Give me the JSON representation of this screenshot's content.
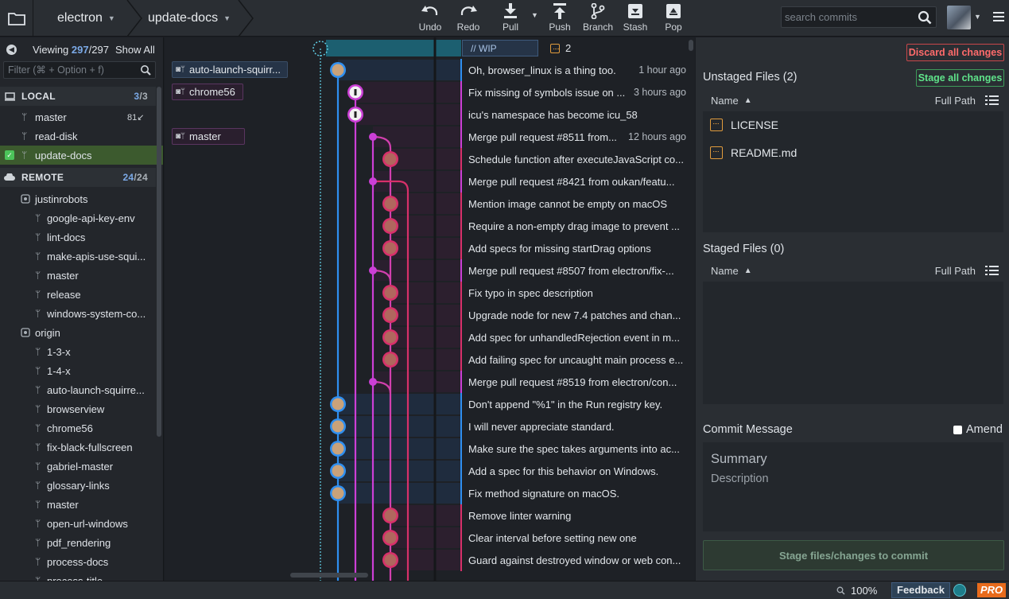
{
  "topbar": {
    "repo_name": "electron",
    "branch_name": "update-docs",
    "tools": [
      {
        "label": "Undo",
        "icon": "undo-icon"
      },
      {
        "label": "Redo",
        "icon": "redo-icon"
      },
      {
        "label": "Pull",
        "icon": "pull-icon"
      },
      {
        "label": "Push",
        "icon": "push-icon"
      },
      {
        "label": "Branch",
        "icon": "branch-icon"
      },
      {
        "label": "Stash",
        "icon": "stash-icon"
      },
      {
        "label": "Pop",
        "icon": "pop-icon"
      }
    ],
    "search_placeholder": "search commits"
  },
  "sidebar": {
    "viewing_label": "Viewing",
    "viewing_count": "297",
    "viewing_total": "/297",
    "show_all": "Show All",
    "filter_placeholder": "Filter (⌘ + Option + f)",
    "local_header": "LOCAL",
    "local_count": "3",
    "local_total": "/3",
    "local_branches": [
      {
        "name": "master",
        "badge": "81↙"
      },
      {
        "name": "read-disk",
        "badge": ""
      },
      {
        "name": "update-docs",
        "badge": ""
      }
    ],
    "remote_header": "REMOTE",
    "remote_count": "24",
    "remote_total": "/24",
    "remote_items": [
      {
        "name": "justinrobots",
        "type": "remote"
      },
      {
        "name": "google-api-key-env",
        "type": "branch"
      },
      {
        "name": "lint-docs",
        "type": "branch"
      },
      {
        "name": "make-apis-use-squi...",
        "type": "branch"
      },
      {
        "name": "master",
        "type": "branch"
      },
      {
        "name": "release",
        "type": "branch"
      },
      {
        "name": "windows-system-co...",
        "type": "branch"
      },
      {
        "name": "origin",
        "type": "remote"
      },
      {
        "name": "1-3-x",
        "type": "branch"
      },
      {
        "name": "1-4-x",
        "type": "branch"
      },
      {
        "name": "auto-launch-squirre...",
        "type": "branch"
      },
      {
        "name": "browserview",
        "type": "branch"
      },
      {
        "name": "chrome56",
        "type": "branch"
      },
      {
        "name": "fix-black-fullscreen",
        "type": "branch"
      },
      {
        "name": "gabriel-master",
        "type": "branch"
      },
      {
        "name": "glossary-links",
        "type": "branch"
      },
      {
        "name": "master",
        "type": "branch"
      },
      {
        "name": "open-url-windows",
        "type": "branch"
      },
      {
        "name": "pdf_rendering",
        "type": "branch"
      },
      {
        "name": "process-docs",
        "type": "branch"
      },
      {
        "name": "process-title",
        "type": "branch"
      }
    ]
  },
  "graph": {
    "wip_label": "// WIP",
    "wip_count": "2",
    "refs": [
      {
        "row": 0,
        "label": "auto-launch-squirr..."
      },
      {
        "row": 1,
        "label": "chrome56"
      },
      {
        "row": 3,
        "label": "master"
      }
    ],
    "commits": [
      {
        "msg": "Oh, browser_linux is a thing too.",
        "time": "1 hour ago",
        "lane": 0
      },
      {
        "msg": "Fix missing of symbols issue on ...",
        "time": "3 hours ago",
        "lane": 1
      },
      {
        "msg": "icu's namespace has become icu_58",
        "time": "",
        "lane": 1
      },
      {
        "msg": "Merge pull request #8511 from...",
        "time": "12 hours ago",
        "lane": 2
      },
      {
        "msg": "Schedule function after executeJavaScript co...",
        "time": "",
        "lane": 3
      },
      {
        "msg": "Merge pull request #8421 from oukan/featu...",
        "time": "",
        "lane": 2
      },
      {
        "msg": "Mention image cannot be empty on macOS",
        "time": "",
        "lane": 3
      },
      {
        "msg": "Require a non-empty drag image to prevent ...",
        "time": "",
        "lane": 3
      },
      {
        "msg": "Add specs for missing startDrag options",
        "time": "",
        "lane": 3
      },
      {
        "msg": "Merge pull request #8507 from electron/fix-...",
        "time": "",
        "lane": 2
      },
      {
        "msg": "Fix typo in spec description",
        "time": "",
        "lane": 3
      },
      {
        "msg": "Upgrade node for new 7.4 patches and chan...",
        "time": "",
        "lane": 3
      },
      {
        "msg": "Add spec for unhandledRejection event in m...",
        "time": "",
        "lane": 3
      },
      {
        "msg": "Add failing spec for uncaught main process e...",
        "time": "",
        "lane": 3
      },
      {
        "msg": "Merge pull request #8519 from electron/con...",
        "time": "",
        "lane": 2
      },
      {
        "msg": "Don't append \"%1\" in the Run registry key.",
        "time": "",
        "lane": 0
      },
      {
        "msg": "I will never appreciate standard.",
        "time": "",
        "lane": 0
      },
      {
        "msg": "Make sure the spec takes arguments into ac...",
        "time": "",
        "lane": 0
      },
      {
        "msg": "Add a spec for this behavior on Windows.",
        "time": "",
        "lane": 0
      },
      {
        "msg": "Fix method signature on macOS.",
        "time": "",
        "lane": 0
      },
      {
        "msg": "Remove linter warning",
        "time": "",
        "lane": 3
      },
      {
        "msg": "Clear interval before setting new one",
        "time": "",
        "lane": 3
      },
      {
        "msg": "Guard against destroyed window or web con...",
        "time": "",
        "lane": 3
      }
    ],
    "lane_colors": [
      "#2f8ff0",
      "#cc3fd6",
      "#cc3fd6",
      "#d8306a"
    ]
  },
  "right": {
    "discard_all": "Discard all changes",
    "stage_all": "Stage all changes",
    "unstaged_title": "Unstaged Files (2)",
    "col_name": "Name",
    "col_path": "Full Path",
    "unstaged_files": [
      "LICENSE",
      "README.md"
    ],
    "staged_title": "Staged Files (0)",
    "commit_title": "Commit Message",
    "amend_label": "Amend",
    "summary_placeholder": "Summary",
    "description_placeholder": "Description",
    "stage_commit_button": "Stage files/changes to commit"
  },
  "statusbar": {
    "zoom": "100%",
    "feedback": "Feedback",
    "pro": "PRO"
  }
}
